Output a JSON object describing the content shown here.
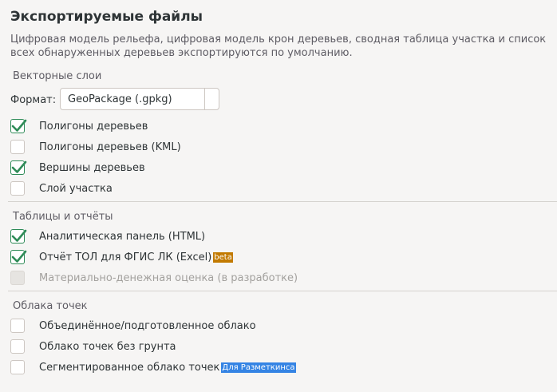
{
  "page": {
    "title": "Экспортируемые файлы",
    "description": "Цифровая модель рельефа, цифровая модель крон деревьев, сводная таблица участка и список всех обнаруженных деревьев экспортируются по умолчанию."
  },
  "vector": {
    "header": "Векторные слои",
    "format_label": "Формат:",
    "format_value": "GeoPackage (.gpkg)",
    "items": [
      {
        "label": "Полигоны деревьев",
        "checked": true
      },
      {
        "label": "Полигоны деревьев (KML)",
        "checked": false
      },
      {
        "label": "Вершины деревьев",
        "checked": true
      },
      {
        "label": "Слой участка",
        "checked": false
      }
    ]
  },
  "tables": {
    "header": "Таблицы и отчёты",
    "items": [
      {
        "label": "Аналитическая панель (HTML)",
        "checked": true
      },
      {
        "label": "Отчёт ТОЛ для ФГИС ЛК (Excel)",
        "checked": true,
        "badge": "beta"
      },
      {
        "label": "Материально-денежная оценка (в разработке)",
        "checked": false,
        "disabled": true
      }
    ]
  },
  "clouds": {
    "header": "Облака точек",
    "items": [
      {
        "label": "Объединённое/подготовленное облако",
        "checked": false
      },
      {
        "label": "Облако точек без грунта",
        "checked": false
      },
      {
        "label": "Сегментированное облако точек",
        "checked": false,
        "badge": "Для Разметкинса"
      }
    ]
  },
  "colors": {
    "check_green": "#2e8b57",
    "beta_badge": "#c27a00",
    "blue_badge": "#3584e4"
  }
}
